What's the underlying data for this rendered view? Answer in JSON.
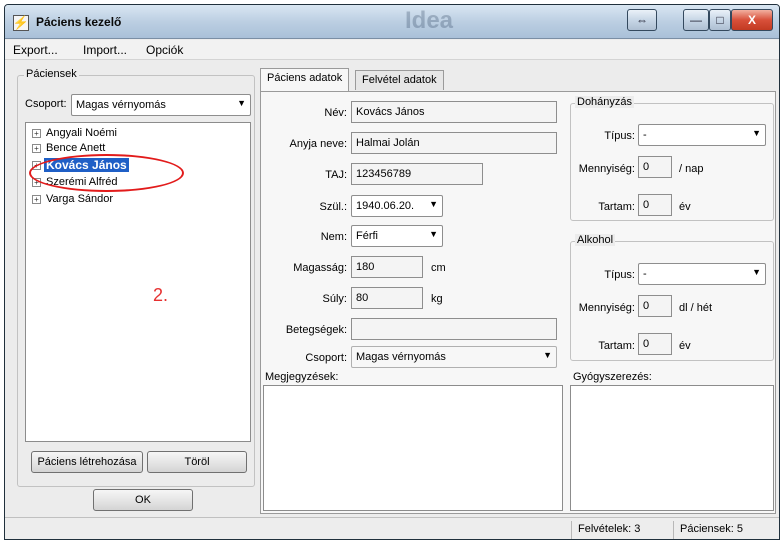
{
  "window": {
    "title": "Páciens kezelő",
    "watermark": "Idea",
    "app_icon": "lightning-icon",
    "controls": {
      "restore": "⇔",
      "minimize": "—",
      "maximize": "□",
      "close": "X"
    }
  },
  "menu": {
    "items": [
      "Export...",
      "Import...",
      "Opciók"
    ]
  },
  "left_panel": {
    "group_title": "Páciensek",
    "group_label": "Csoport:",
    "group_value": "Magas vérnyomás",
    "patients": [
      {
        "name": "Angyali Noémi",
        "selected": false
      },
      {
        "name": "Bence Anett",
        "selected": false
      },
      {
        "name": "Kovács János",
        "selected": true
      },
      {
        "name": "Szerémi Alfréd",
        "selected": false
      },
      {
        "name": "Varga Sándor",
        "selected": false
      }
    ],
    "create_button": "Páciens létrehozása",
    "delete_button": "Töröl",
    "ok_button": "OK"
  },
  "annotation": {
    "number": "2.",
    "color": "#e21b1b"
  },
  "tabs": [
    "Páciens adatok",
    "Felvétel adatok"
  ],
  "patient_form": {
    "name_label": "Név:",
    "name": "Kovács János",
    "mother_label": "Anyja neve:",
    "mother": "Halmai Jolán",
    "taj_label": "TAJ:",
    "taj": "123456789",
    "birth_label": "Szül.:",
    "birth": "1940.06.20.",
    "sex_label": "Nem:",
    "sex": "Férfi",
    "height_label": "Magasság:",
    "height": "180",
    "height_unit": "cm",
    "weight_label": "Súly:",
    "weight": "80",
    "weight_unit": "kg",
    "diseases_label": "Betegségek:",
    "diseases": "",
    "group_label": "Csoport:",
    "group": "Magas vérnyomás",
    "notes_label": "Megjegyzések:"
  },
  "smoking": {
    "title": "Dohányzás",
    "type_label": "Típus:",
    "type": "-",
    "amount_label": "Mennyiség:",
    "amount": "0",
    "amount_unit": "/ nap",
    "duration_label": "Tartam:",
    "duration": "0",
    "duration_unit": "év"
  },
  "alcohol": {
    "title": "Alkohol",
    "type_label": "Típus:",
    "type": "-",
    "amount_label": "Mennyiség:",
    "amount": "0",
    "amount_unit": "dl / hét",
    "duration_label": "Tartam:",
    "duration": "0",
    "duration_unit": "év"
  },
  "medication_label": "Gyógyszerezés:",
  "status": {
    "admissions": "Felvételek: 3",
    "patients": "Páciensek: 5"
  }
}
